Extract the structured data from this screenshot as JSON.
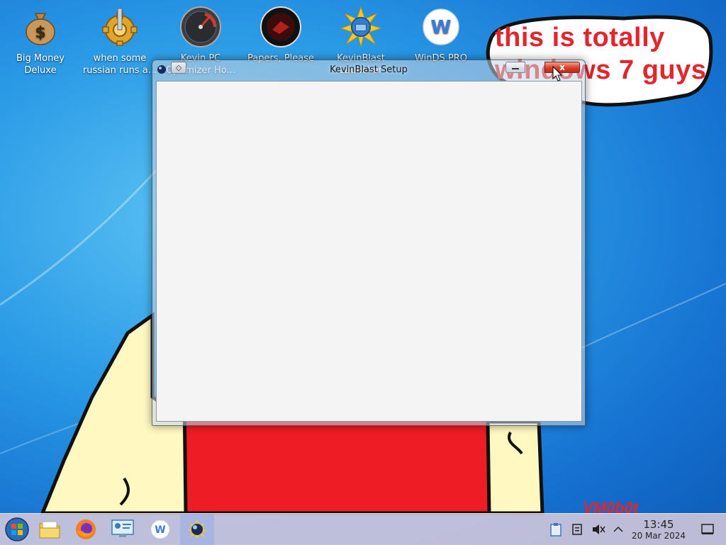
{
  "desktop": {
    "icons": [
      {
        "label": "Big Money Deluxe",
        "icon": "money-bag-icon"
      },
      {
        "label": "when some russian runs a...",
        "icon": "gear-icon"
      },
      {
        "label": "Kevin PC Optimizer Ho...",
        "icon": "speedometer-icon"
      },
      {
        "label": "Papers, Please",
        "icon": "papers-please-icon"
      },
      {
        "label": "KevinBlast Launcher",
        "icon": "kevinblast-icon"
      },
      {
        "label": "WinDS PRO",
        "icon": "w-logo-icon"
      }
    ],
    "speech_bubble": "this is totally windows 7 guys",
    "watermark": "VM0b0t"
  },
  "window": {
    "title": "KevinBlast Setup",
    "close_glyph": "x"
  },
  "taskbar": {
    "buttons": [
      {
        "name": "start-button",
        "icon": "windows-orb-icon"
      },
      {
        "name": "file-manager-button",
        "icon": "folder-icon"
      },
      {
        "name": "firefox-button",
        "icon": "firefox-icon"
      },
      {
        "name": "control-panel-button",
        "icon": "control-panel-icon"
      },
      {
        "name": "winds-pro-button",
        "icon": "w-logo-icon"
      },
      {
        "name": "kevinblast-task-button",
        "icon": "kevinblast-icon",
        "active": true
      }
    ],
    "tray": {
      "clock_time": "13:45",
      "clock_date": "20 Mar 2024"
    }
  },
  "colors": {
    "bubble_text": "#e2262c",
    "taskbar_bg": "#dccddc",
    "window_client": "#f4f4f4",
    "close_button": "#d9402a"
  }
}
